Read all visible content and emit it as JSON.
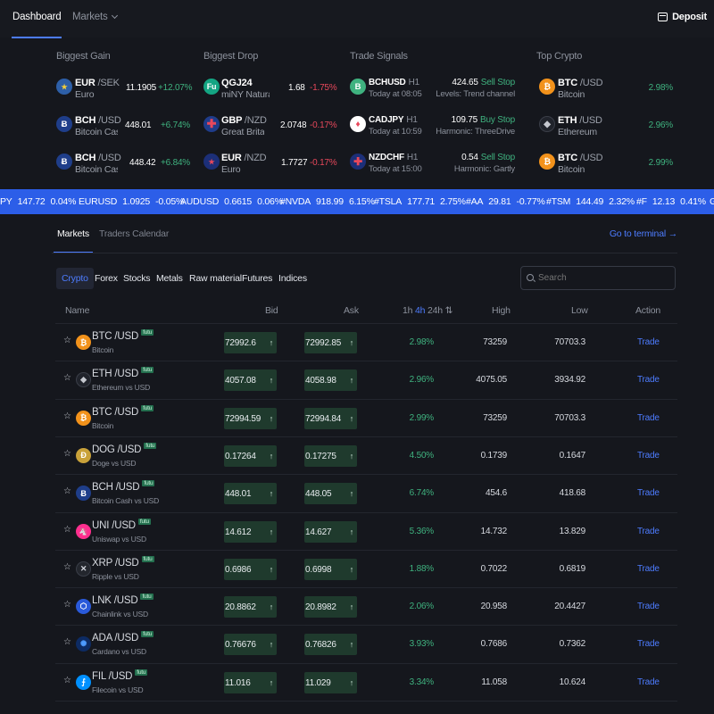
{
  "nav": {
    "dashboard": "Dashboard",
    "markets": "Markets",
    "deposit": "Deposit"
  },
  "overview": {
    "biggest_gain": {
      "title": "Biggest Gain",
      "items": [
        {
          "base": "EUR",
          "quote": "/SEK",
          "sub": "Euro",
          "price": "11.1905",
          "change": "+12.07%"
        },
        {
          "base": "BCH",
          "quote": "/USD",
          "sub": "Bitcoin Cas...",
          "price": "448.01",
          "change": "+6.74%"
        },
        {
          "base": "BCH",
          "quote": "/USD",
          "sub": "Bitcoin Cas...",
          "price": "448.42",
          "change": "+6.84%"
        }
      ]
    },
    "biggest_drop": {
      "title": "Biggest Drop",
      "items": [
        {
          "base": "QGJ24",
          "quote": "",
          "sub": "miNY Natura...",
          "price": "1.68",
          "change": "-1.75%"
        },
        {
          "base": "GBP",
          "quote": "/NZD",
          "sub": "Great Brita...",
          "price": "2.0748",
          "change": "-0.17%"
        },
        {
          "base": "EUR",
          "quote": "/NZD",
          "sub": "Euro",
          "price": "1.7727",
          "change": "-0.17%"
        }
      ]
    },
    "trade_signals": {
      "title": "Trade Signals",
      "items": [
        {
          "symbol": "BCHUSD",
          "tf": "H1",
          "time": "Today at 08:05",
          "price": "424.65",
          "action": "Sell Stop",
          "desc": "Levels: Trend channel"
        },
        {
          "symbol": "CADJPY",
          "tf": "H1",
          "time": "Today at 10:59",
          "price": "109.75",
          "action": "Buy Stop",
          "desc": "Harmonic: ThreeDrive"
        },
        {
          "symbol": "NZDCHF",
          "tf": "H1",
          "time": "Today at 15:00",
          "price": "0.54",
          "action": "Sell Stop",
          "desc": "Harmonic: Gartly"
        }
      ]
    },
    "top_crypto": {
      "title": "Top Crypto",
      "items": [
        {
          "base": "BTC",
          "quote": "/USD",
          "sub": "Bitcoin",
          "change": "2.98%"
        },
        {
          "base": "ETH",
          "quote": "/USD",
          "sub": "Ethereum",
          "change": "2.96%"
        },
        {
          "base": "BTC",
          "quote": "/USD",
          "sub": "Bitcoin",
          "change": "2.99%"
        }
      ]
    }
  },
  "ticker": [
    {
      "symbol": "PY",
      "price": "147.72",
      "change": "0.04%"
    },
    {
      "symbol": "EURUSD",
      "price": "1.0925",
      "change": "-0.05%"
    },
    {
      "symbol": "AUDUSD",
      "price": "0.6615",
      "change": "0.06%"
    },
    {
      "symbol": "#NVDA",
      "price": "918.99",
      "change": "6.15%"
    },
    {
      "symbol": "#TSLA",
      "price": "177.71",
      "change": "2.75%"
    },
    {
      "symbol": "#AA",
      "price": "29.81",
      "change": "-0.77%"
    },
    {
      "symbol": "#TSM",
      "price": "144.49",
      "change": "2.32%"
    },
    {
      "symbol": "#F",
      "price": "12.13",
      "change": "0.41%"
    },
    {
      "symbol": "G",
      "price": "",
      "change": ""
    }
  ],
  "section": {
    "tab_markets": "Markets",
    "tab_calendar": "Traders Calendar",
    "go_terminal": "Go to terminal →"
  },
  "categories": [
    "Crypto",
    "Forex",
    "Stocks",
    "Metals",
    "Raw material",
    "Futures",
    "Indices"
  ],
  "search": {
    "placeholder": "Search"
  },
  "table": {
    "headers": {
      "name": "Name",
      "bid": "Bid",
      "ask": "Ask",
      "period_1h": "1h",
      "period_4h": "4h",
      "period_24h": "24h",
      "sort_icon": "⇅",
      "high": "High",
      "low": "Low",
      "action": "Action"
    },
    "badge": "futu",
    "trade_label": "Trade",
    "rows": [
      {
        "base": "BTC",
        "quote": "/USD",
        "sub": "Bitcoin",
        "bid": "72992.6",
        "ask": "72992.85",
        "change": "2.98%",
        "high": "73259",
        "low": "70703.3"
      },
      {
        "base": "ETH",
        "quote": "/USD",
        "sub": "Ethereum vs USD",
        "bid": "4057.08",
        "ask": "4058.98",
        "change": "2.96%",
        "high": "4075.05",
        "low": "3934.92"
      },
      {
        "base": "BTC",
        "quote": "/USD",
        "sub": "Bitcoin",
        "bid": "72994.59",
        "ask": "72994.84",
        "change": "2.99%",
        "high": "73259",
        "low": "70703.3"
      },
      {
        "base": "DOG",
        "quote": "/USD",
        "sub": "Doge vs USD",
        "bid": "0.17264",
        "ask": "0.17275",
        "change": "4.50%",
        "high": "0.1739",
        "low": "0.1647"
      },
      {
        "base": "BCH",
        "quote": "/USD",
        "sub": "Bitcoin Cash vs USD",
        "bid": "448.01",
        "ask": "448.05",
        "change": "6.74%",
        "high": "454.6",
        "low": "418.68"
      },
      {
        "base": "UNI",
        "quote": "/USD",
        "sub": "Uniswap vs USD",
        "bid": "14.612",
        "ask": "14.627",
        "change": "5.36%",
        "high": "14.732",
        "low": "13.829"
      },
      {
        "base": "XRP",
        "quote": "/USD",
        "sub": "Ripple vs USD",
        "bid": "0.6986",
        "ask": "0.6998",
        "change": "1.88%",
        "high": "0.7022",
        "low": "0.6819"
      },
      {
        "base": "LNK",
        "quote": "/USD",
        "sub": "Chainlink vs USD",
        "bid": "20.8862",
        "ask": "20.8982",
        "change": "2.06%",
        "high": "20.958",
        "low": "20.4427"
      },
      {
        "base": "ADA",
        "quote": "/USD",
        "sub": "Cardano vs USD",
        "bid": "0.76676",
        "ask": "0.76826",
        "change": "3.93%",
        "high": "0.7686",
        "low": "0.7362"
      },
      {
        "base": "FIL",
        "quote": "/USD",
        "sub": "Filecoin vs USD",
        "bid": "11.016",
        "ask": "11.029",
        "change": "3.34%",
        "high": "11.058",
        "low": "10.624"
      }
    ]
  },
  "colors": {
    "accent": "#4d7cff",
    "ticker_bg": "#2c5ee8",
    "up": "#3fb27f",
    "down": "#e8485b",
    "bid_box": "#1f3a2d"
  }
}
